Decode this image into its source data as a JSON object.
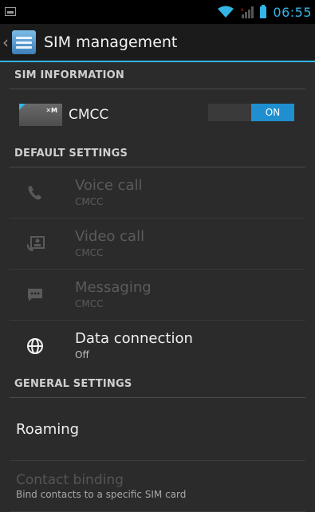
{
  "status_bar": {
    "time": "06:55",
    "accent": "#33b5e5"
  },
  "action_bar": {
    "title": "SIM management",
    "icon": "sim-settings-icon"
  },
  "sim_information": {
    "header": "SIM INFORMATION",
    "sim": {
      "name": "CMCC",
      "toggle": "ON"
    }
  },
  "default_settings": {
    "header": "DEFAULT SETTINGS",
    "items": [
      {
        "title": "Voice call",
        "sub": "CMCC",
        "icon": "phone-icon",
        "enabled": false
      },
      {
        "title": "Video call",
        "sub": "CMCC",
        "icon": "video-call-icon",
        "enabled": false
      },
      {
        "title": "Messaging",
        "sub": "CMCC",
        "icon": "message-icon",
        "enabled": false
      },
      {
        "title": "Data connection",
        "sub": "Off",
        "icon": "globe-icon",
        "enabled": true
      }
    ]
  },
  "general_settings": {
    "header": "GENERAL SETTINGS",
    "roaming": "Roaming",
    "contact_binding": {
      "title": "Contact binding",
      "sub": "Bind contacts to a specific SIM card"
    }
  }
}
